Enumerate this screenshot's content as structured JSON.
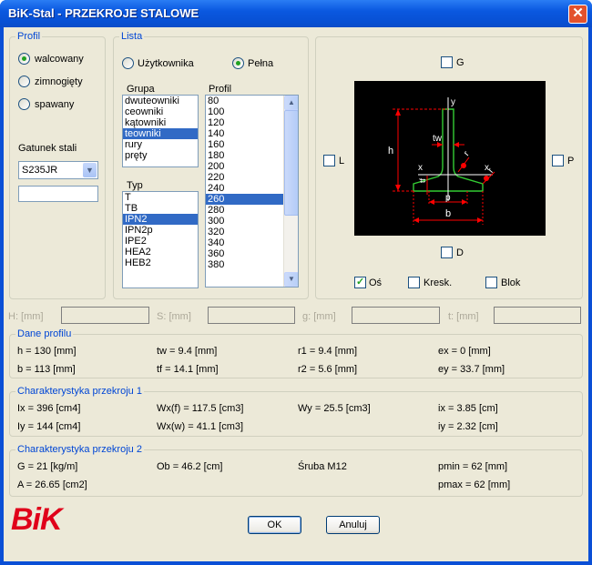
{
  "window": {
    "title": "BiK-Stal - PRZEKROJE STALOWE",
    "close_glyph": "✕"
  },
  "profil": {
    "label": "Profil",
    "options": [
      "walcowany",
      "zimnogięty",
      "spawany"
    ],
    "selected": 0,
    "grade_label": "Gatunek stali",
    "grade_value": "S235JR",
    "extra_value": ""
  },
  "lista": {
    "label": "Lista",
    "options": [
      "Użytkownika",
      "Pełna"
    ],
    "selected": 1,
    "grupa_label": "Grupa",
    "grupa_items": [
      "dwuteowniki",
      "ceowniki",
      "kątowniki",
      "teowniki",
      "rury",
      "pręty"
    ],
    "grupa_selected": 3,
    "typ_label": "Typ",
    "typ_items": [
      "T",
      "TB",
      "IPN2",
      "IPN2p",
      "IPE2",
      "HEA2",
      "HEB2"
    ],
    "typ_selected": 2,
    "profil_label": "Profil",
    "profil_items": [
      "80",
      "100",
      "120",
      "140",
      "160",
      "180",
      "200",
      "220",
      "240",
      "260",
      "280",
      "300",
      "320",
      "340",
      "360",
      "380"
    ],
    "profil_selected": 9
  },
  "preview": {
    "checks": {
      "top": "G",
      "left": "L",
      "right": "P",
      "bottom": "D"
    },
    "opts": [
      {
        "label": "Oś",
        "checked": true
      },
      {
        "label": "Kresk.",
        "checked": false
      },
      {
        "label": "Blok",
        "checked": false
      }
    ],
    "dims": {
      "h": "h",
      "tw": "tw",
      "tf": "tf",
      "b": "b",
      "r": "r",
      "x": "x",
      "y": "y",
      "p": "p"
    }
  },
  "params": [
    "H: [mm]",
    "S: [mm]",
    "g: [mm]",
    "t: [mm]"
  ],
  "dane": {
    "label": "Dane profilu",
    "rows": [
      [
        "h = 130 [mm]",
        "tw = 9.4 [mm]",
        "r1 = 9.4 [mm]",
        "ex = 0 [mm]"
      ],
      [
        "b = 113 [mm]",
        "tf = 14.1 [mm]",
        "r2 = 5.6 [mm]",
        "ey = 33.7 [mm]"
      ]
    ]
  },
  "char1": {
    "label": "Charakterystyka przekroju 1",
    "rows": [
      [
        "Ix = 396 [cm4]",
        "Wx(f) = 117.5 [cm3]",
        "Wy = 25.5 [cm3]",
        "ix = 3.85 [cm]"
      ],
      [
        "Iy = 144 [cm4]",
        "Wx(w) = 41.1 [cm3]",
        "",
        "iy = 2.32 [cm]"
      ]
    ]
  },
  "char2": {
    "label": "Charakterystyka przekroju 2",
    "rows": [
      [
        "G = 21 [kg/m]",
        "Ob = 46.2 [cm]",
        "Śruba M12",
        "pmin = 62  [mm]"
      ],
      [
        "A = 26.65 [cm2]",
        "",
        "",
        "pmax = 62  [mm]"
      ]
    ]
  },
  "logo": "BiK",
  "buttons": {
    "ok": "OK",
    "cancel": "Anuluj"
  },
  "colors": {
    "title_bar": "#0a58e0",
    "selection": "#316ac5",
    "group_label": "#0046d5",
    "logo": "#e0001a",
    "section": "#33cc33",
    "dim": "#ff0000"
  }
}
